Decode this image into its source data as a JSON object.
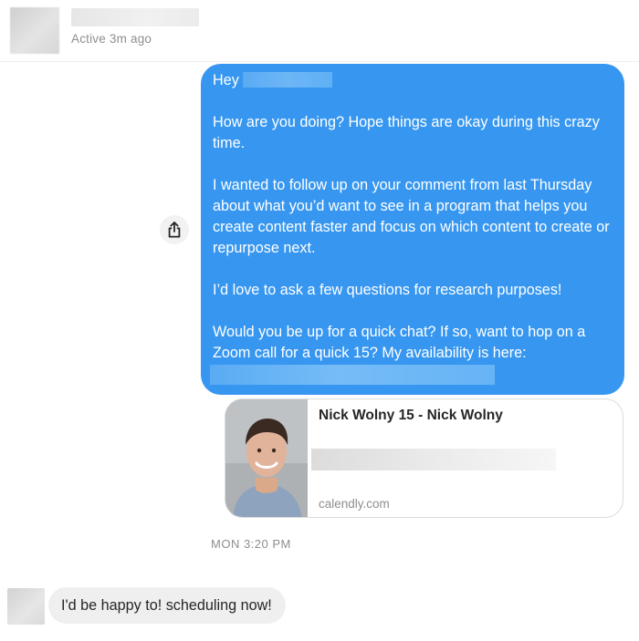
{
  "header": {
    "status": "Active 3m ago"
  },
  "outgoing_message": {
    "greeting": "Hey",
    "paragraphs": [
      "How are you doing? Hope things are okay during this crazy time.",
      "I wanted to follow up on your comment from last Thursday about what you’d want to see in a program that helps you create content faster and focus on which content to create or repurpose next.",
      "I’d love to ask a few questions for research purposes!",
      "Would you be up for a quick chat? If so, want to hop on a Zoom call for a quick 15? My availability is here:"
    ]
  },
  "link_preview": {
    "title": "Nick Wolny 15 - Nick Wolny",
    "domain": "calendly.com"
  },
  "timestamp": "MON 3:20 PM",
  "incoming_message": {
    "text": "I'd be happy to! scheduling now!"
  },
  "icons": {
    "share": "share-icon"
  },
  "colors": {
    "outgoing_bubble": "#3797f0",
    "incoming_bubble": "#efefef",
    "secondary_text": "#8e8e8e"
  }
}
